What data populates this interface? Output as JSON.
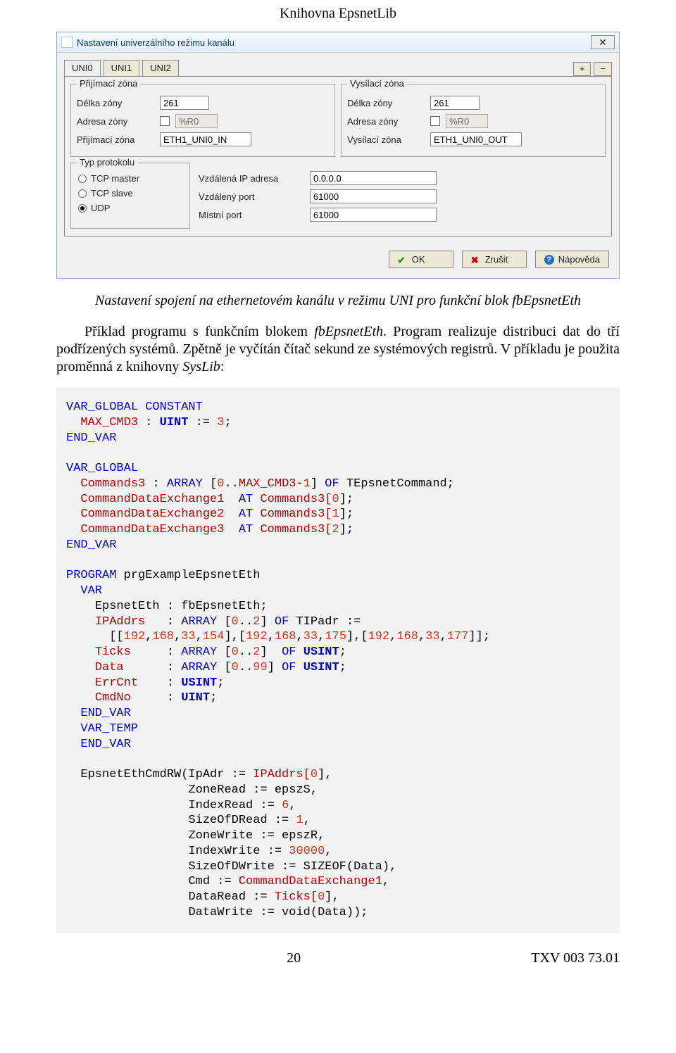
{
  "page_header": "Knihovna EpsnetLib",
  "dialog": {
    "title": "Nastavení univerzálního režimu kanálu",
    "close_glyph": "✕",
    "tabs": [
      "UNI0",
      "UNI1",
      "UNI2"
    ],
    "tab_plus": "+",
    "tab_minus": "−",
    "recv_zone": {
      "legend": "Přijímací zóna",
      "length_label": "Délka zóny",
      "length_value": "261",
      "addr_label": "Adresa zóny",
      "addr_value": "%R0",
      "name_label": "Přijímací zóna",
      "name_value": "ETH1_UNI0_IN"
    },
    "send_zone": {
      "legend": "Vysílací zóna",
      "length_label": "Délka zóny",
      "length_value": "261",
      "addr_label": "Adresa zóny",
      "addr_value": "%R0",
      "name_label": "Vysílací zóna",
      "name_value": "ETH1_UNI0_OUT"
    },
    "protocol": {
      "legend": "Typ protokolu",
      "opt_tcp_master": "TCP master",
      "opt_tcp_slave": "TCP slave",
      "opt_udp": "UDP"
    },
    "remote": {
      "ip_label": "Vzdálená IP adresa",
      "ip_value": "0.0.0.0",
      "remote_port_label": "Vzdálený port",
      "remote_port_value": "61000",
      "local_port_label": "Místní port",
      "local_port_value": "61000"
    },
    "buttons": {
      "ok": "OK",
      "cancel": "Zrušit",
      "help": "Nápověda"
    }
  },
  "caption": "Nastavení spojení na ethernetovém kanálu v režimu UNI pro funkční blok fbEpsnetEth",
  "para1_a": "Příklad programu s funkčním blokem ",
  "para1_b": "fbEpsnetEth",
  "para1_c": ". Program realizuje distribuci dat do tří podřízených systémů. Zpětně je vyčítán čítač sekund ze systémových registrů. V příkladu je použita proměnná z knihovny ",
  "para1_d": "SysLib",
  "para1_e": ":",
  "code": {
    "l01a": "VAR_GLOBAL CONSTANT",
    "l02a": "MAX_CMD3",
    "l02b": " : ",
    "l02c": "UINT",
    "l02d": " := ",
    "l02e": "3",
    "l02f": ";",
    "l03a": "END_VAR",
    "l05a": "VAR_GLOBAL",
    "l06a": "Commands3",
    "l06b": " : ",
    "l06c": "ARRAY ",
    "l06d": "[",
    "l06e": "0",
    "l06f": "..",
    "l06g": "MAX_CMD3",
    "l06h": "-",
    "l06i": "1",
    "l06j": "]",
    "l06k": " OF ",
    "l06l": "TEpsnetCommand;",
    "l07a": "CommandDataExchange1",
    "l07b": "  AT ",
    "l07c": "Commands3[",
    "l07d": "0",
    "l07e": "];",
    "l08a": "CommandDataExchange2",
    "l08b": "  AT ",
    "l08c": "Commands3[",
    "l08d": "1",
    "l08e": "];",
    "l09a": "CommandDataExchange3",
    "l09b": "  AT ",
    "l09c": "Commands3[",
    "l09d": "2",
    "l09e": "];",
    "l10a": "END_VAR",
    "l12a": "PROGRAM ",
    "l12b": "prgExampleEpsnetEth",
    "l13a": "VAR",
    "l14a": "EpsnetEth : fbEpsnetEth;",
    "l15a": "IPAddrs",
    "l15b": "   : ",
    "l15c": "ARRAY ",
    "l15d": "[",
    "l15e": "0",
    "l15f": "..",
    "l15g": "2",
    "l15h": "]",
    "l15i": " OF ",
    "l15j": "TIPadr :=",
    "l16a": "[[",
    "l16b": "192",
    "l16c": ",",
    "l16d": "168",
    "l16e": ",",
    "l16f": "33",
    "l16g": ",",
    "l16h": "154",
    "l16i": "],[",
    "l16j": "192",
    "l16k": ",",
    "l16l": "168",
    "l16m": ",",
    "l16n": "33",
    "l16o": ",",
    "l16p": "175",
    "l16q": "],[",
    "l16r": "192",
    "l16s": ",",
    "l16t": "168",
    "l16u": ",",
    "l16v": "33",
    "l16w": ",",
    "l16x": "177",
    "l16y": "]];",
    "l17a": "Ticks",
    "l17b": "     : ",
    "l17c": "ARRAY ",
    "l17d": "[",
    "l17e": "0",
    "l17f": "..",
    "l17g": "2",
    "l17h": "]",
    "l17i": "  OF ",
    "l17j": "USINT",
    "l17k": ";",
    "l18a": "Data",
    "l18b": "      : ",
    "l18c": "ARRAY ",
    "l18d": "[",
    "l18e": "0",
    "l18f": "..",
    "l18g": "99",
    "l18h": "]",
    "l18i": " OF ",
    "l18j": "USINT",
    "l18k": ";",
    "l19a": "ErrCnt",
    "l19b": "    : ",
    "l19c": "USINT",
    "l19d": ";",
    "l20a": "CmdNo",
    "l20b": "     : ",
    "l20c": "UINT",
    "l20d": ";",
    "l21a": "END_VAR",
    "l22a": "VAR_TEMP",
    "l23a": "END_VAR",
    "l25a": "EpsnetEthCmdRW(IpAdr := ",
    "l25b": "IPAddrs[",
    "l25c": "0",
    "l25d": "]",
    "l25e": ",",
    "l26a": "ZoneRead := epszS,",
    "l27a": "IndexRead := ",
    "l27b": "6",
    "l27c": ",",
    "l28a": "SizeOfDRead := ",
    "l28b": "1",
    "l28c": ",",
    "l29a": "ZoneWrite := epszR,",
    "l30a": "IndexWrite := ",
    "l30b": "30000",
    "l30c": ",",
    "l31a": "SizeOfDWrite := SIZEOF(Data),",
    "l32a": "Cmd := ",
    "l32b": "CommandDataExchange1",
    "l32c": ",",
    "l33a": "DataRead := ",
    "l33b": "Ticks[",
    "l33c": "0",
    "l33d": "]",
    "l33e": ",",
    "l34a": "DataWrite := void(Data));"
  },
  "footer": {
    "page_number": "20",
    "doc_code": "TXV 003 73.01"
  }
}
